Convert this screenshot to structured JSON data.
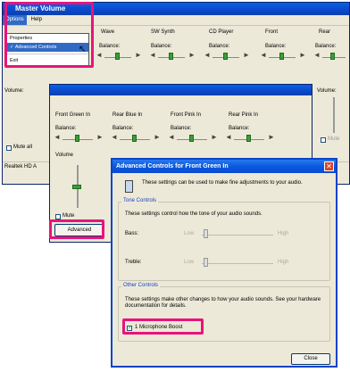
{
  "master": {
    "title": "Master Volume",
    "menu": [
      "Options",
      "Help"
    ],
    "columns": [
      "Wave",
      "SW Synth",
      "CD Player",
      "Front",
      "Rear"
    ],
    "balance_label": "Balance:",
    "volume_label": "Volume:",
    "mute_all_label": "Mute all",
    "mute_label": "Mute",
    "status": "Realtek HD A"
  },
  "options_menu": {
    "items": [
      "Properties",
      "Advanced Controls",
      "Exit"
    ],
    "checked": "Advanced Controls"
  },
  "recording": {
    "columns": [
      "Front Green In",
      "Rear Blue In",
      "Front Pink In",
      "Rear Pink In"
    ],
    "balance_label": "Balance:",
    "volume_label": "Volume",
    "mute_label": "Mute",
    "advanced_button": "Advanced"
  },
  "dialog": {
    "title": "Advanced Controls for Front Green In",
    "intro": "These settings can be used to make fine adjustments to your audio.",
    "tone_group": "Tone Controls",
    "tone_desc": "These settings control how the tone of your audio sounds.",
    "bass_label": "Bass:",
    "treble_label": "Treble:",
    "low_label": "Low",
    "high_label": "High",
    "other_group": "Other Controls",
    "other_desc": "These settings make other changes to how your audio sounds. See your hardware documentation for details.",
    "mic_boost_label": "1 Microphone Boost",
    "mic_boost_checked": true,
    "close_button": "Close"
  },
  "highlight_color": "#e8147a"
}
